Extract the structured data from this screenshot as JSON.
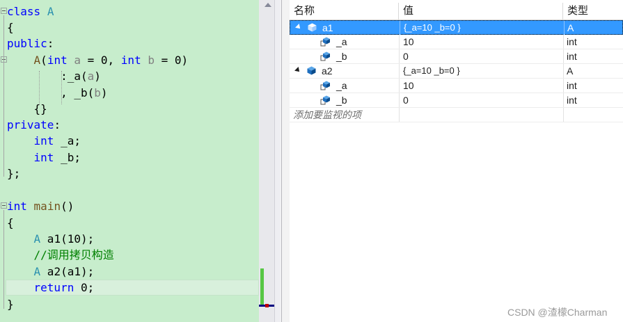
{
  "editor": {
    "code": {
      "l1_kw": "class",
      "l1_name": "A",
      "l2": "{",
      "l3_kw": "public",
      "l3_colon": ":",
      "l4_ctor": "A",
      "l4_open": "(",
      "l4_int1": "int",
      "l4_a": "a",
      "l4_mid1": " = 0, ",
      "l4_int2": "int",
      "l4_b": "b",
      "l4_end": " = 0)",
      "l5_pre": ":_a(",
      "l5_a": "a",
      "l5_post": ")",
      "l6_pre": ", _b(",
      "l6_b": "b",
      "l6_post": ")",
      "l7": "{}",
      "l8_kw": "private",
      "l8_colon": ":",
      "l9_kw": "int",
      "l9_rest": " _a;",
      "l10_kw": "int",
      "l10_rest": " _b;",
      "l11": "};",
      "l12_kw": "int",
      "l12_fn": "main",
      "l12_rest": "()",
      "l13": "{",
      "l14_type": "A",
      "l14_rest": " a1(10);",
      "l15_comment": "//调用拷贝构造",
      "l16_type": "A",
      "l16_rest": " a2(a1);",
      "l17_kw": "return",
      "l17_rest": " 0;",
      "l18": "}"
    }
  },
  "watch": {
    "headers": {
      "name": "名称",
      "value": "值",
      "type": "类型"
    },
    "rows": [
      {
        "name": "a1",
        "value": "{_a=10 _b=0 }",
        "type": "A"
      },
      {
        "name": "_a",
        "value": "10",
        "type": "int"
      },
      {
        "name": "_b",
        "value": "0",
        "type": "int"
      },
      {
        "name": "a2",
        "value": "{_a=10 _b=0 }",
        "type": "A"
      },
      {
        "name": "_a",
        "value": "10",
        "type": "int"
      },
      {
        "name": "_b",
        "value": "0",
        "type": "int"
      }
    ],
    "add_placeholder": "添加要监视的项"
  },
  "watermark": "CSDN @渣檬Charman",
  "colors": {
    "editor_bg": "#c7edcc",
    "keyword": "#0000ff",
    "type_name": "#2b91af",
    "function": "#74531f",
    "parameter": "#808080",
    "comment": "#008000",
    "selection": "#3399ff"
  }
}
